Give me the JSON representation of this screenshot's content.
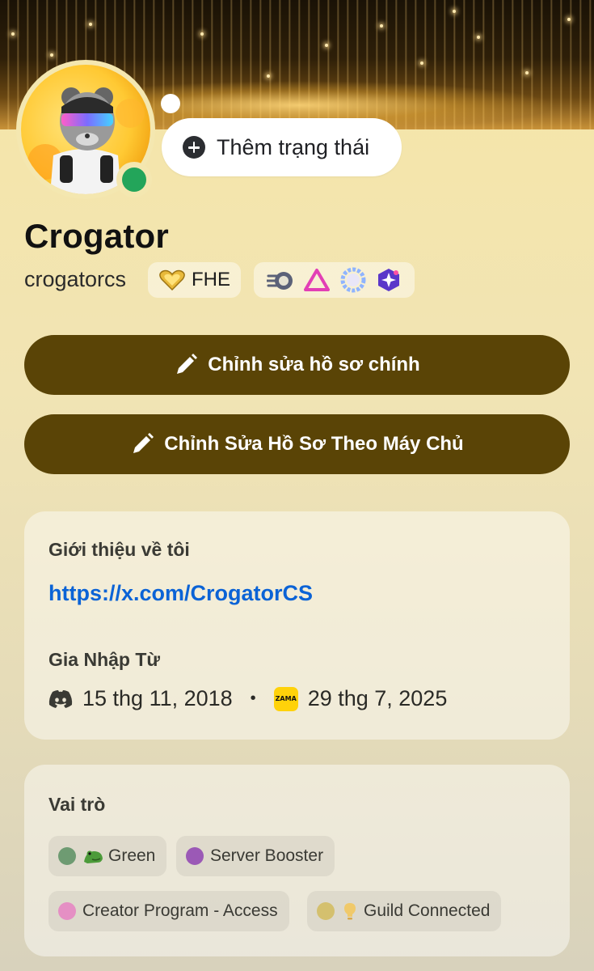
{
  "profile": {
    "display_name": "Crogator",
    "username": "crogatorcs",
    "status_placeholder": "Thêm trạng thái",
    "online_color": "#23a55a",
    "guild_tag": "FHE"
  },
  "actions": {
    "edit_main_profile": "Chỉnh sửa hồ sơ chính",
    "edit_server_profile": "Chỉnh Sửa Hồ Sơ Theo Máy Chủ",
    "button_color": "#5a4406"
  },
  "about": {
    "title": "Giới thiệu về tôi",
    "link": "https://x.com/CrogatorCS",
    "member_since_title": "Gia Nhập Từ",
    "discord_joined": "15 thg 11, 2018",
    "separator": "•",
    "server_icon_label": "ZAMA",
    "server_joined": "29 thg 7, 2025"
  },
  "roles": {
    "title": "Vai trò",
    "items": [
      {
        "label": "Green",
        "color": "#6e9b72",
        "emoji": "frog-icon"
      },
      {
        "label": "Server Booster",
        "color": "#9b59b6"
      },
      {
        "label": "Creator Program - Access",
        "color": "#e58fc4"
      },
      {
        "label": "Guild Connected",
        "color": "#d4c06e",
        "emoji": "lightbulb-icon"
      }
    ]
  }
}
